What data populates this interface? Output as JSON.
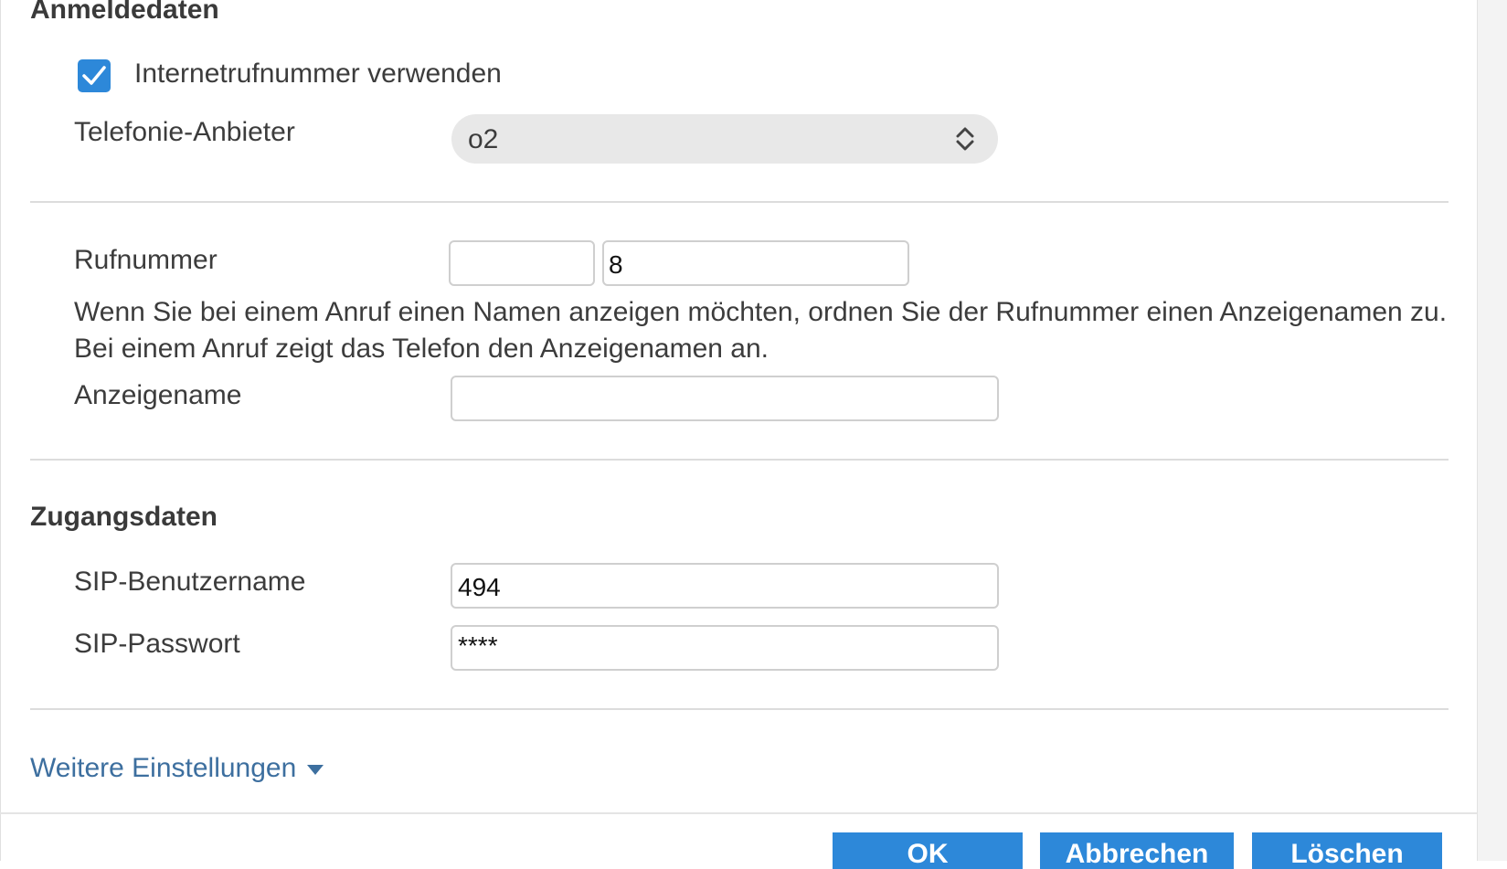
{
  "sections": {
    "login_title": "Anmeldedaten",
    "access_title": "Zugangsdaten"
  },
  "internet_number": {
    "label": "Internetrufnummer verwenden",
    "checked": true
  },
  "provider": {
    "label": "Telefonie-Anbieter",
    "selected": "o2"
  },
  "number": {
    "label": "Rufnummer",
    "prefix_value": "",
    "value": "8"
  },
  "help_text": {
    "line1": "Wenn Sie bei einem Anruf einen Namen anzeigen möchten, ordnen Sie der Rufnummer einen Anzeigenamen zu.",
    "line2": "Bei einem Anruf zeigt das Telefon den Anzeigenamen an."
  },
  "display_name": {
    "label": "Anzeigename",
    "value": ""
  },
  "sip_user": {
    "label": "SIP-Benutzername",
    "value": "494"
  },
  "sip_password": {
    "label": "SIP-Passwort",
    "value": "****"
  },
  "more_settings": {
    "label": "Weitere Einstellungen"
  },
  "buttons": {
    "ok": "OK",
    "cancel": "Abbrechen",
    "delete": "Löschen"
  },
  "colors": {
    "accent": "#2d88d9",
    "link": "#3d6f9f"
  },
  "icons": {
    "checkbox": "checkmark-icon",
    "select": "up-down-chevron-icon",
    "more_settings": "triangle-down-icon"
  }
}
